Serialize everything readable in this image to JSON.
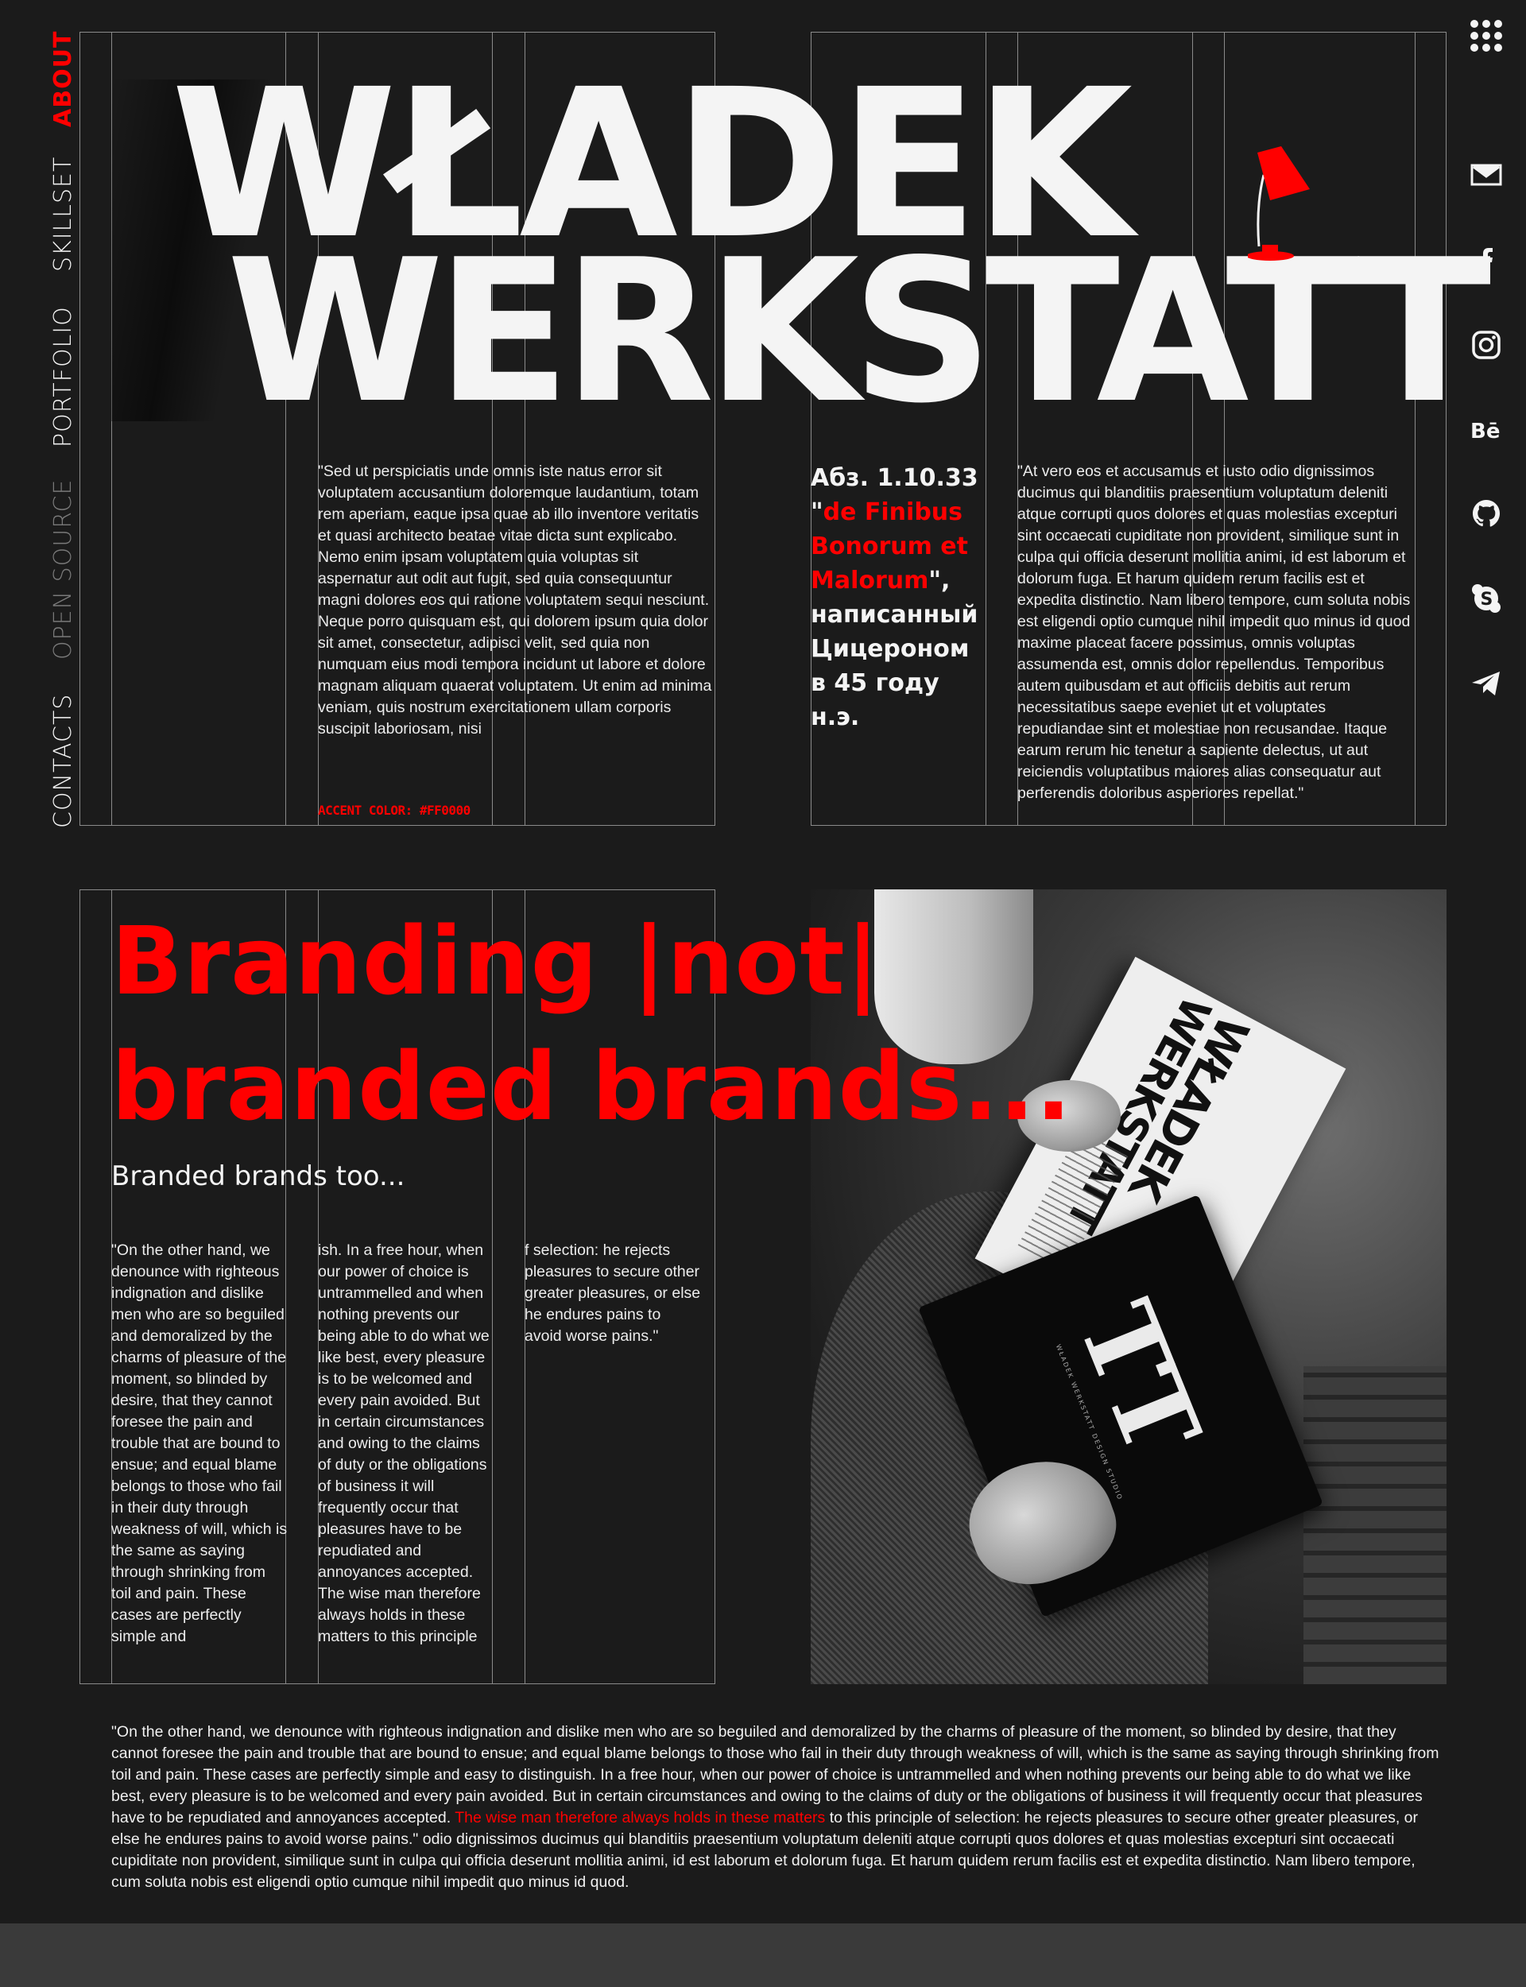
{
  "nav": {
    "about": "ABOUT",
    "skillset": "SKILLSET",
    "portfolio": "PORTFOLIO",
    "open_source": "OPEN SOURCE",
    "contacts": "CONTACTS"
  },
  "hero": {
    "line1": "WŁADEK",
    "line2": "WERKSTATT"
  },
  "intro": {
    "quote": "\"Sed ut perspiciatis unde omnis iste natus error sit voluptatem accusantium doloremque laudantium, totam rem aperiam, eaque ipsa quae ab illo inventore veritatis et quasi architecto beatae vitae dicta sunt explicabo. Nemo enim ipsam voluptatem quia voluptas sit aspernatur aut odit aut fugit, sed quia consequuntur magni dolores eos qui ratione voluptatem sequi nesciunt. Neque porro quisquam est, qui dolorem ipsum quia dolor sit amet, consectetur, adipisci velit, sed quia non numquam eius modi tempora incidunt ut labore et dolore magnam aliquam quaerat voluptatem. Ut enim ad minima veniam, quis nostrum exercitationem ullam corporis suscipit laboriosam, nisi",
    "accent_label": "ACCENT COLOR: #FF0000"
  },
  "sidenote": {
    "prefix": "Абз. 1.10.33 \"",
    "highlight": "de Finibus Bonorum et Malorum",
    "suffix": "\", написанный Цицероном в 45 году н.э."
  },
  "right_quote": "\"At vero eos et accusamus et iusto odio dignissimos ducimus qui blanditiis praesentium voluptatum deleniti atque corrupti quos dolores et quas molestias excepturi sint occaecati cupiditate non provident, similique sunt in culpa qui officia deserunt mollitia animi, id est laborum et dolorum fuga. Et harum quidem rerum facilis est et expedita distinctio. Nam libero tempore, cum soluta nobis est eligendi optio cumque nihil impedit quo minus id quod maxime placeat facere possimus, omnis voluptas assumenda est, omnis dolor repellendus. Temporibus autem quibusdam et aut officiis debitis aut rerum necessitatibus saepe eveniet ut et voluptates repudiandae sint et molestiae non recusandae. Itaque earum rerum hic tenetur a sapiente delectus, ut aut reiciendis voluptatibus maiores alias consequatur aut perferendis doloribus asperiores repellat.\"",
  "branding": {
    "line1": "Branding |not|",
    "line2": "branded brands...",
    "subtitle": "Branded brands too..."
  },
  "columns": {
    "col1": "\"On the other hand, we denounce with righteous indignation and dislike men who are so beguiled and demoralized by the charms of pleasure of the moment, so blinded by desire, that they cannot foresee the pain and trouble that are bound to ensue; and equal blame belongs to those who fail in their duty through weakness of will, which is the same as saying through shrinking from toil and pain. These cases are perfectly simple and",
    "col2": "ish. In a free hour, when our power of choice is untrammelled and when nothing prevents our being able to do what we like best, every pleasure is to be welcomed and every pain avoided. But in certain circumstances and owing to the claims of duty or the obligations of business it will frequently occur that pleasures have to be repudiated and annoyances accepted. The wise man therefore always holds in these matters to this principle",
    "col3": "f selection: he rejects pleasures to secure other greater pleasures, or else he endures pains to avoid worse pains.\""
  },
  "book_cover": {
    "title_line1": "WŁADEK",
    "title_line2": "WERKSTATT",
    "monogram": "TT",
    "caption": "WŁADEK WERKSTATT DESIGN STUDIO"
  },
  "bottom": {
    "before": "\"On the other hand, we denounce with righteous indignation and dislike men who are so beguiled and demoralized by the charms of pleasure of the moment, so blinded by desire, that they cannot foresee the pain and trouble that are bound to ensue; and equal blame belongs to those who fail in their duty through weakness of will, which is the same as saying through shrinking from toil and pain. These cases are perfectly simple and easy to distinguish. In a free hour, when our power of choice is untrammelled and when nothing prevents our being able to do what we like best, every pleasure is to be welcomed and every pain avoided. But in certain circumstances and owing to the claims of duty or the obligations of business it will frequently occur that pleasures have to be repudiated and annoyances accepted. ",
    "highlight": "The wise man therefore always holds in these matters",
    "after": " to this principle of selection: he rejects pleasures to secure other greater pleasures, or else he endures pains to avoid worse pains.\"   odio dignissimos ducimus qui blanditiis praesentium voluptatum deleniti atque corrupti quos dolores et quas molestias excepturi sint occaecati cupiditate non provident, similique sunt in culpa qui officia deserunt mollitia animi, id est laborum et dolorum fuga. Et harum quidem rerum facilis est et expedita distinctio. Nam libero tempore, cum soluta nobis est eligendi optio cumque nihil impedit quo minus id quod."
  },
  "social_icons": [
    "mail-icon",
    "facebook-icon",
    "instagram-icon",
    "behance-icon",
    "github-icon",
    "skype-icon",
    "telegram-icon"
  ],
  "colors": {
    "background": "#1b1b1b",
    "accent": "#ff0000",
    "text": "#f4f4f4",
    "grid": "#8a8a8a",
    "footer": "#3a3a3a"
  }
}
